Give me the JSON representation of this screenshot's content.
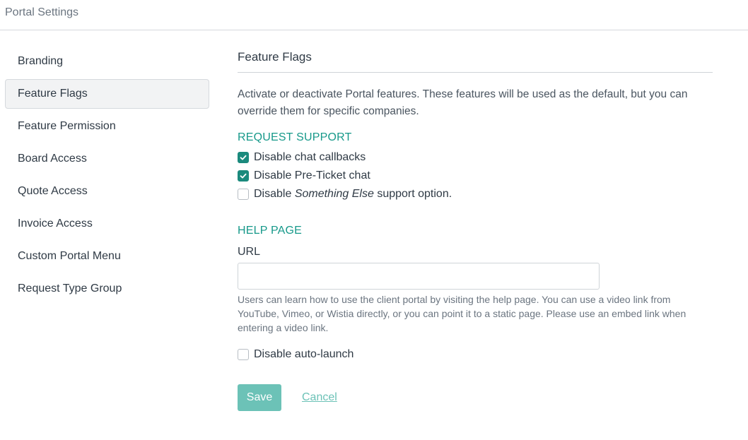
{
  "window": {
    "title": "Portal Settings"
  },
  "sidebar": {
    "items": [
      {
        "label": "Branding",
        "active": false
      },
      {
        "label": "Feature Flags",
        "active": true
      },
      {
        "label": "Feature Permission",
        "active": false
      },
      {
        "label": "Board Access",
        "active": false
      },
      {
        "label": "Quote Access",
        "active": false
      },
      {
        "label": "Invoice Access",
        "active": false
      },
      {
        "label": "Custom Portal Menu",
        "active": false
      },
      {
        "label": "Request Type Group",
        "active": false
      }
    ]
  },
  "main": {
    "title": "Feature Flags",
    "intro": "Activate or deactivate Portal features. These features will be used as the default, but you can override them for specific companies.",
    "request_support": {
      "heading": "REQUEST SUPPORT",
      "options": [
        {
          "label": "Disable chat callbacks",
          "checked": true
        },
        {
          "label": "Disable Pre-Ticket chat",
          "checked": true
        },
        {
          "label_prefix": "Disable ",
          "label_italic": "Something Else",
          "label_suffix": " support option.",
          "checked": false
        }
      ]
    },
    "help_page": {
      "heading": "HELP PAGE",
      "url_label": "URL",
      "url_value": "",
      "url_placeholder": "",
      "help_text": "Users can learn how to use the client portal by visiting the help page. You can use a video link from YouTube, Vimeo, or Wistia directly, or you can point it to a static page. Please use an embed link when entering a video link.",
      "auto_launch": {
        "label": "Disable auto-launch",
        "checked": false
      }
    },
    "actions": {
      "save_label": "Save",
      "cancel_label": "Cancel"
    }
  },
  "colors": {
    "accent": "#17998a",
    "checkbox_checked": "#1b8a7d",
    "save_button": "#6cc2b7"
  },
  "icons": {
    "checkbox_check": "check-icon"
  }
}
